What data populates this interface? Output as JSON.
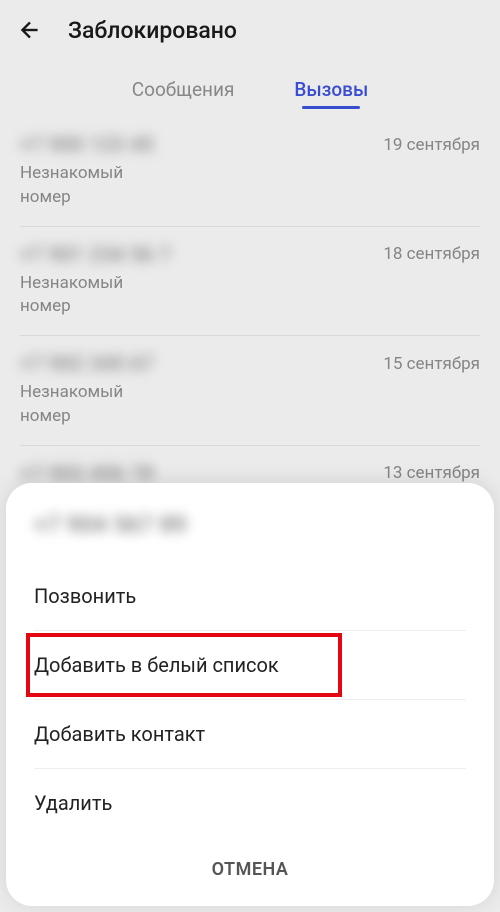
{
  "header": {
    "title": "Заблокировано"
  },
  "tabs": {
    "messages": "Сообщения",
    "calls": "Вызовы"
  },
  "list": [
    {
      "phone": "+7 900 123 45",
      "date": "19 сентября",
      "sublabel": "Незнакомый номер"
    },
    {
      "phone": "+7 901 234 56 7",
      "date": "18 сентября",
      "sublabel": "Незнакомый номер"
    },
    {
      "phone": "+7 902 345 67",
      "date": "15 сентября",
      "sublabel": "Незнакомый номер"
    },
    {
      "phone": "+7 903 456 78",
      "date": "13 сентября",
      "sublabel": ""
    }
  ],
  "sheet": {
    "title_phone": "+7 904 567 89",
    "actions": {
      "call": "Позвонить",
      "whitelist": "Добавить в белый список",
      "add_contact": "Добавить контакт",
      "delete": "Удалить"
    },
    "cancel": "ОТМЕНА"
  }
}
